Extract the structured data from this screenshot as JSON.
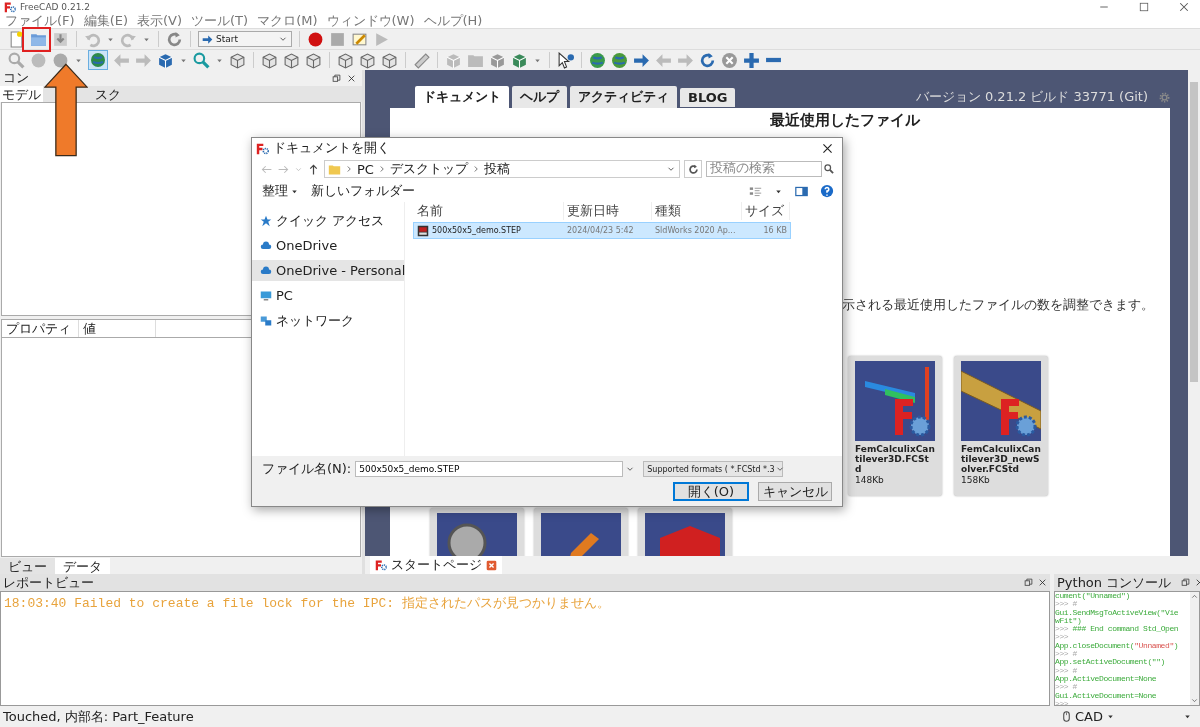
{
  "window": {
    "title": "FreeCAD 0.21.2"
  },
  "menu": [
    "ファイル(F)",
    "編集(E)",
    "表示(V)",
    "ツール(T)",
    "マクロ(M)",
    "ウィンドウ(W)",
    "ヘルプ(H)"
  ],
  "toolbar": {
    "workbench": "Start"
  },
  "combo_view": {
    "title": "コン",
    "tabs": [
      {
        "label": "モデル",
        "selected": true
      },
      {
        "label": "スク",
        "selected": false
      }
    ]
  },
  "property_view": {
    "columns": [
      "プロパティ",
      "値"
    ],
    "tabs": [
      {
        "label": "ビュー",
        "selected": false
      },
      {
        "label": "データ",
        "selected": true
      }
    ]
  },
  "start_page": {
    "tabs": [
      {
        "label": "ドキュメント",
        "selected": true
      },
      {
        "label": "ヘルプ",
        "selected": false
      },
      {
        "label": "アクティビティ",
        "selected": false
      },
      {
        "label": "BLOG",
        "selected": false
      }
    ],
    "version": "バージョン 0.21.2 ビルド 33771 (Git)",
    "heading": "最近使用したファイル",
    "note": "示される最近使用したファイルの数を調整できます。",
    "recent_files": [
      {
        "name": "FemCalculixCantilever3D.FCStd",
        "size": "148Kb",
        "kind": "beam"
      },
      {
        "name": "FemCalculixCantilever3D_newSolver.FCStd",
        "size": "158Kb",
        "kind": "mesh"
      }
    ],
    "more_files": [
      {
        "kind": "tool"
      },
      {
        "kind": "robot"
      },
      {
        "kind": "box"
      }
    ]
  },
  "document_tabs": [
    {
      "label": "スタートページ",
      "selected": true
    }
  ],
  "dialog": {
    "title": "ドキュメントを開く",
    "path": [
      "PC",
      "デスクトップ",
      "投稿"
    ],
    "search": {
      "placeholder": "投稿の検索"
    },
    "organize": "整理",
    "new_folder": "新しいフォルダー",
    "nav": [
      {
        "label": "クイック アクセス",
        "selected": false,
        "kind": "star"
      },
      {
        "label": "OneDrive",
        "selected": false,
        "kind": "cloud"
      },
      {
        "label": "OneDrive - Personal",
        "selected": true,
        "kind": "cloud"
      },
      {
        "label": "PC",
        "selected": false,
        "kind": "pc"
      },
      {
        "label": "ネットワーク",
        "selected": false,
        "kind": "network"
      }
    ],
    "columns": [
      "名前",
      "更新日時",
      "種類",
      "サイズ"
    ],
    "files": [
      {
        "name": "500x50x5_demo.STEP",
        "modified": "2024/04/23 5:42",
        "type": "SldWorks 2020 Ap...",
        "size": "16 KB",
        "selected": true
      }
    ],
    "filename_label": "ファイル名(N):",
    "filename": "500x50x5_demo.STEP",
    "filter": "Supported formats ( *.FCStd *.3",
    "buttons": [
      {
        "label": "開く(O)",
        "kind": "primary"
      },
      {
        "label": "キャンセル",
        "kind": "normal"
      }
    ]
  },
  "report_view": {
    "title": "レポートビュー",
    "lines": [
      {
        "text": "18:03:40  Failed to create a file lock for the IPC: 指定されたパスが見つかりません。",
        "kind": "warning"
      }
    ]
  },
  "python_console": {
    "title": "Python コンソール",
    "lines": [
      {
        "segments": [
          {
            "kind": "code",
            "text": "cument(\"Unnamed\")"
          }
        ]
      },
      {
        "segments": [
          {
            "kind": "prompt",
            "text": ">>> #"
          }
        ]
      },
      {
        "segments": [
          {
            "kind": "code",
            "text": "Gui.SendMsgToActiveView(\"Vie"
          }
        ]
      },
      {
        "segments": [
          {
            "kind": "code",
            "text": "wFit\")"
          }
        ]
      },
      {
        "segments": [
          {
            "kind": "prompt",
            "text": ">>> "
          },
          {
            "kind": "code",
            "text": "### End command Std_Open"
          }
        ]
      },
      {
        "segments": [
          {
            "kind": "prompt",
            "text": ">>>"
          }
        ]
      },
      {
        "segments": [
          {
            "kind": "code",
            "text": "App.closeDocument("
          },
          {
            "kind": "string",
            "text": "\"Unnamed\""
          },
          {
            "kind": "code",
            "text": ")"
          }
        ]
      },
      {
        "segments": [
          {
            "kind": "prompt",
            "text": ">>> #"
          }
        ]
      },
      {
        "segments": [
          {
            "kind": "code",
            "text": "App.setActiveDocument(\"\")"
          }
        ]
      },
      {
        "segments": [
          {
            "kind": "prompt",
            "text": ">>> #"
          }
        ]
      },
      {
        "segments": [
          {
            "kind": "code",
            "text": "App.ActiveDocument=None"
          }
        ]
      },
      {
        "segments": [
          {
            "kind": "prompt",
            "text": ">>> #"
          }
        ]
      },
      {
        "segments": [
          {
            "kind": "code",
            "text": "Gui.ActiveDocument=None"
          }
        ]
      },
      {
        "segments": [
          {
            "kind": "prompt",
            "text": ">>>"
          }
        ]
      }
    ]
  },
  "status_bar": {
    "message": "Touched, 内部名: Part_Feature",
    "navigation": "CAD"
  }
}
